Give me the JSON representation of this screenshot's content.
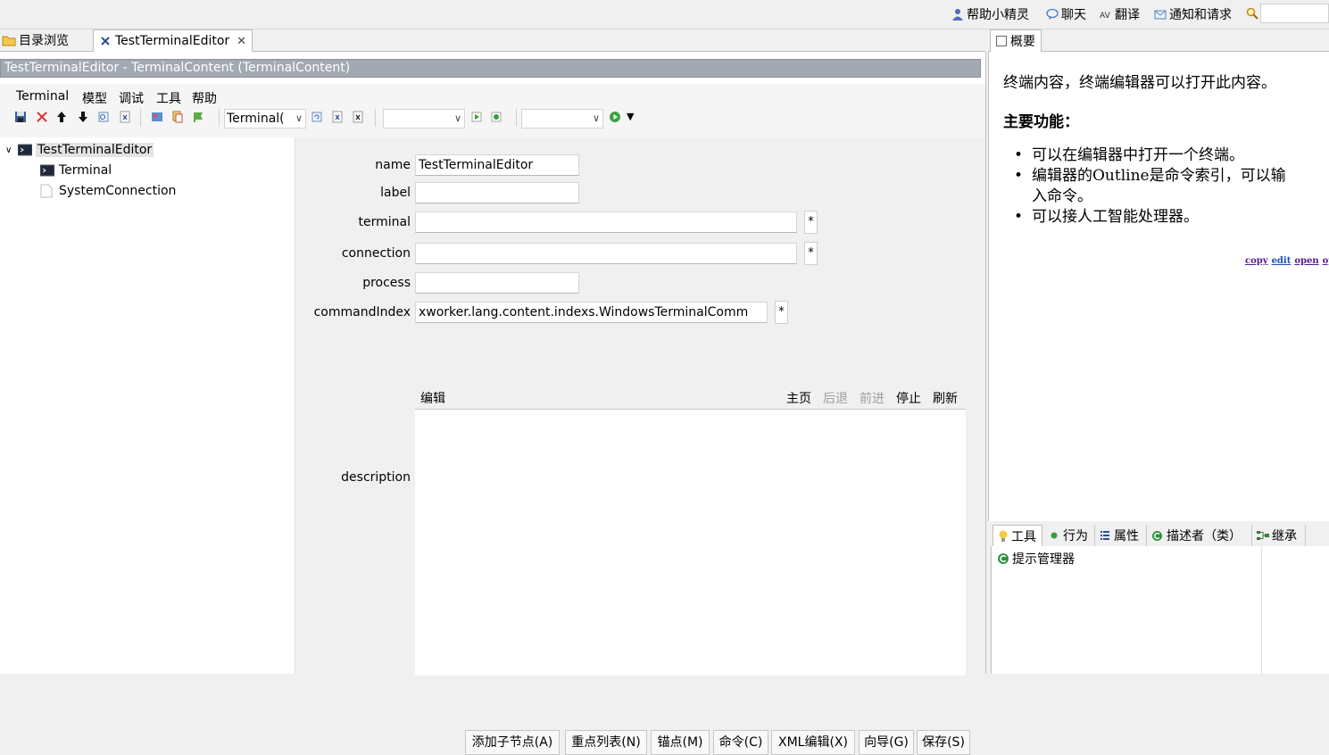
{
  "header": {
    "items": [
      {
        "label": "帮助小精灵",
        "icon": "person-icon"
      },
      {
        "label": "聊天",
        "icon": "chat-icon"
      },
      {
        "label": "翻译",
        "icon": "translate-icon"
      },
      {
        "label": "通知和请求",
        "icon": "mail-icon"
      }
    ],
    "search_icon": "search-icon"
  },
  "editor_tabs": [
    {
      "label": "目录浏览",
      "active": false
    },
    {
      "label": "TestTerminalEditor",
      "active": true
    }
  ],
  "editor": {
    "title": "TestTerminalEditor - TerminalContent  (TerminalContent)",
    "menu": [
      "Terminal",
      "模型",
      "调试",
      "工具",
      "帮助"
    ],
    "toolbar": {
      "combo1_value": "Terminal(",
      "combo2_value": "",
      "combo3_value": ""
    }
  },
  "tree": {
    "items": [
      {
        "label": "TestTerminalEditor",
        "icon": "terminal-icon",
        "selected": true
      },
      {
        "label": "Terminal",
        "icon": "terminal-icon"
      },
      {
        "label": "SystemConnection",
        "icon": "document-icon"
      }
    ]
  },
  "form": {
    "fields": {
      "name": {
        "label": "name",
        "value": "TestTerminalEditor"
      },
      "label": {
        "label": "label",
        "value": ""
      },
      "terminal": {
        "label": "terminal",
        "value": "",
        "button": "*"
      },
      "connection": {
        "label": "connection",
        "value": "",
        "button": "*"
      },
      "process": {
        "label": "process",
        "value": ""
      },
      "commandIndex": {
        "label": "commandIndex",
        "value": "xworker.lang.content.indexs.WindowsTerminalComm",
        "button": "*"
      }
    },
    "description": {
      "label": "description",
      "edit_link": "编辑",
      "nav": [
        "主页",
        "后退",
        "前进",
        "停止",
        "刷新"
      ]
    },
    "buttons": [
      "添加子节点(A)",
      "重点列表(N)",
      "锚点(M)",
      "命令(C)",
      "XML编辑(X)",
      "向导(G)",
      "保存(S)"
    ]
  },
  "overview": {
    "tab": "概要",
    "text": "终端内容，终端编辑器可以打开此内容。",
    "heading": "主要功能：",
    "list": [
      "可以在编辑器中打开一个终端。",
      "编辑器的Outline是命令索引，可以输",
      "入命令。",
      "可以接人工智能处理器。"
    ],
    "links": [
      "copy",
      "edit",
      "open",
      "openu"
    ]
  },
  "bottom_panel": {
    "tabs": [
      "工具",
      "行为",
      "属性",
      "描述者（类）",
      "继承"
    ],
    "items": [
      "提示管理器"
    ]
  }
}
